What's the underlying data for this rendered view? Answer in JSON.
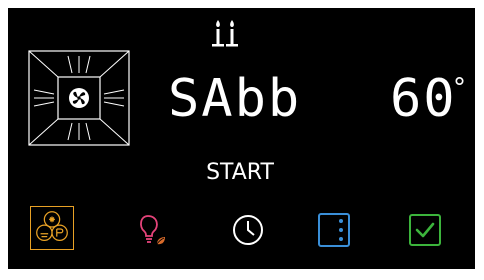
{
  "display": {
    "mode_text": "SAbb",
    "temperature_value": "60",
    "temperature_unit": "°",
    "start_label": "START"
  },
  "icons": {
    "fan": "fan-icon",
    "candles": "candles-icon",
    "settings": "settings-icon",
    "light": "light-bulb-icon",
    "timer": "clock-icon",
    "door": "door-icon",
    "confirm": "checkbox-icon"
  },
  "colors": {
    "settings": "#e8a125",
    "light": "#e5437a",
    "door": "#3a8fd8",
    "confirm": "#3cb43c",
    "text": "#ffffff"
  }
}
